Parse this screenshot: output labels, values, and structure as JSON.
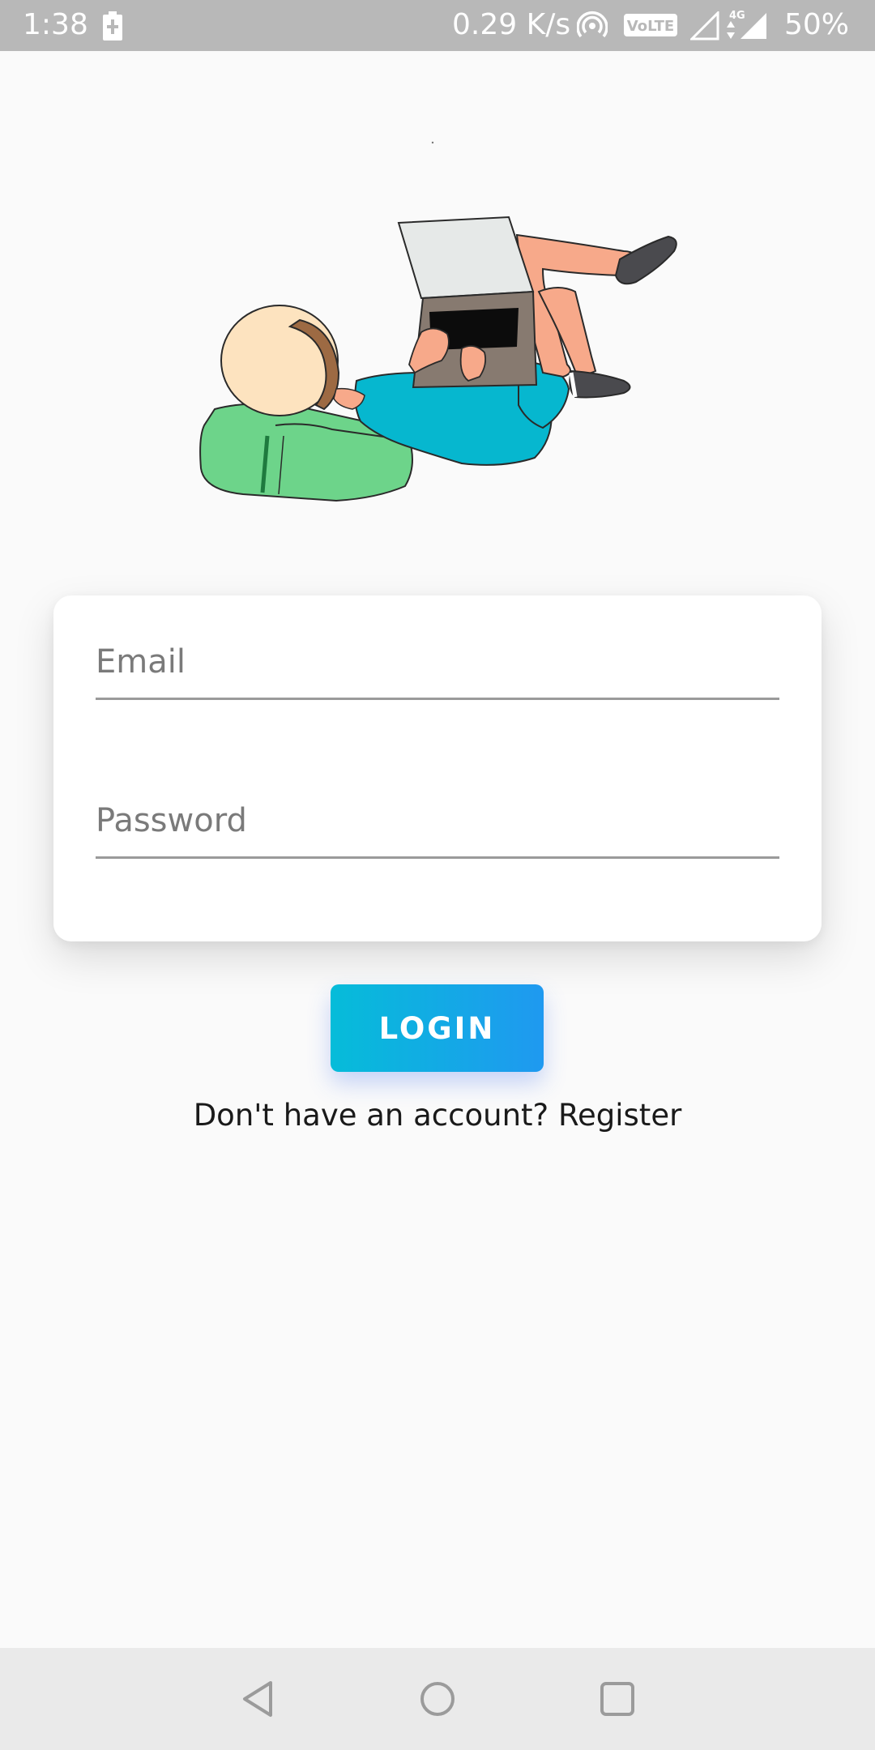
{
  "status_bar": {
    "time": "1:38",
    "net_speed": "0.29 K/s",
    "volte_label": "VoLTE",
    "net_type": "4G",
    "battery_level": "50%",
    "icons": [
      "battery-charging-icon",
      "hotspot-icon",
      "signal-empty-icon",
      "data-arrows-icon",
      "signal-full-icon"
    ]
  },
  "illustration": {
    "description_icon": "person-with-laptop-illustration"
  },
  "login_form": {
    "email_placeholder": "Email",
    "email_value": "",
    "password_placeholder": "Password",
    "password_value": ""
  },
  "login_button": {
    "label": "LOGIN"
  },
  "register_prompt": {
    "text": "Don't have an account?",
    "link": "Register"
  },
  "nav_bar": {
    "icons": [
      "back-icon",
      "home-icon",
      "recents-icon"
    ]
  },
  "colors": {
    "status_bar": "#b8b8b8",
    "background": "#fafafa",
    "card": "#ffffff",
    "button_gradient_start": "#06bcd9",
    "button_gradient_end": "#1f99f0",
    "nav_bar": "#eaeaea"
  }
}
